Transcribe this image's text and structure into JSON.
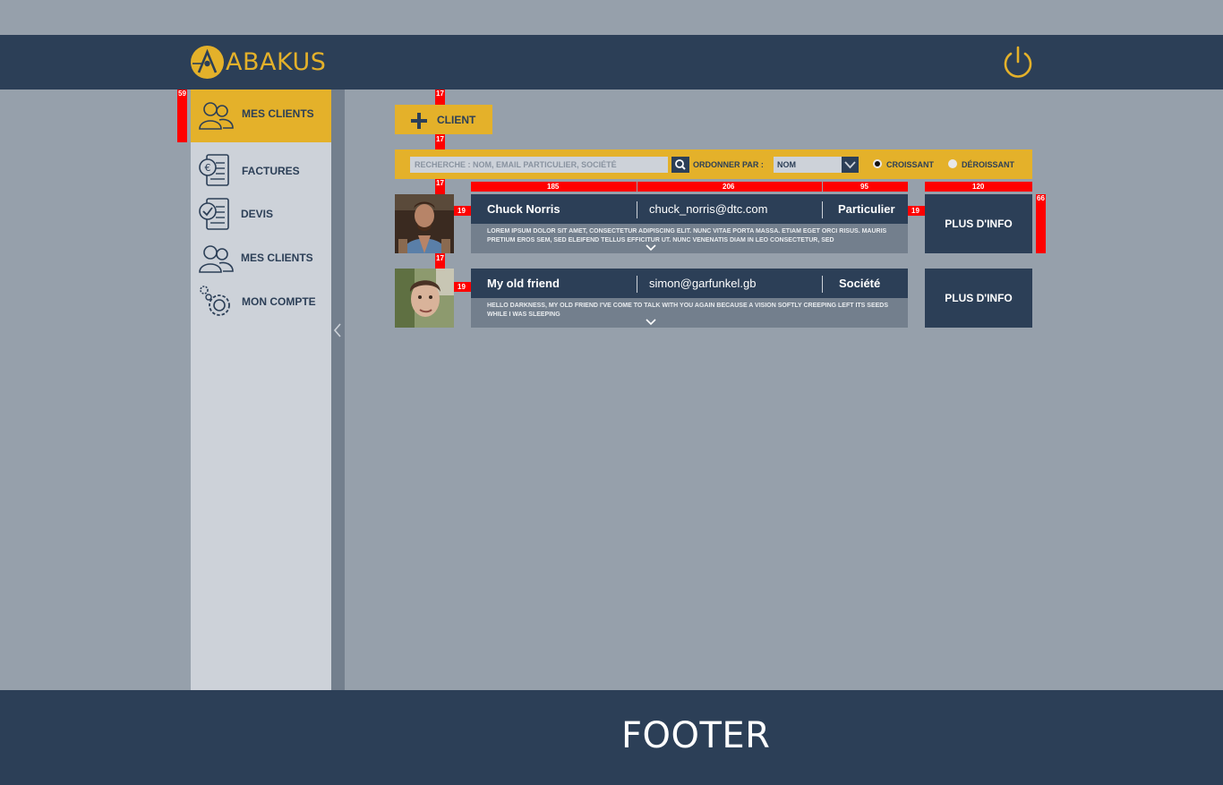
{
  "header": {
    "logo_text": "ABAKUS",
    "accent_color": "#e4b12a",
    "background_color": "#2c3f57",
    "power_icon": "power-icon"
  },
  "sidebar": {
    "items": [
      {
        "label": "MES CLIENTS",
        "icon": "clients-icon",
        "active": true
      },
      {
        "label": "FACTURES",
        "icon": "invoice-euro-icon"
      },
      {
        "label": "DEVIS",
        "icon": "quote-check-icon"
      },
      {
        "label": "MES CLIENTS",
        "icon": "clients-icon"
      },
      {
        "label": "MON COMPTE",
        "icon": "gears-icon"
      }
    ],
    "collapse_icon": "chevron-left-icon"
  },
  "toolbar": {
    "add_client_label": "CLIENT"
  },
  "filters": {
    "search_placeholder": "RECHERCHE : NOM, EMAIL PARTICULIER, SOCIÉTÉ",
    "order_label": "ORDONNER PAR :",
    "order_value": "NOM",
    "asc_label": "CROISSANT",
    "desc_label": "DÉROISSANT",
    "sort": "CROISSANT"
  },
  "clients": [
    {
      "name": "Chuck Norris",
      "email": "chuck_norris@dtc.com",
      "type": "Particulier",
      "description": "LOREM IPSUM DOLOR SIT AMET, CONSECTETUR ADIPISCING ELIT. NUNC VITAE PORTA MASSA. ETIAM EGET ORCI RISUS. MAURIS PRETIUM EROS SEM, SED ELEIFEND TELLUS EFFICITUR UT. NUNC VENENATIS DIAM IN LEO CONSECTETUR, SED",
      "button": "PLUS D'INFO"
    },
    {
      "name": "My old friend",
      "email": "simon@garfunkel.gb",
      "type": "Société",
      "description": "HELLO DARKNESS, MY OLD FRIEND I'VE COME TO TALK WITH YOU AGAIN BECAUSE A VISION SOFTLY CREEPING LEFT ITS SEEDS WHILE I WAS SLEEPING",
      "button": "PLUS D'INFO"
    }
  ],
  "annotations": {
    "sidebar_item_height": "59",
    "gap_a": "17",
    "gap_b": "17",
    "gap_c": "17",
    "gap_d": "17",
    "avatar_gap": "19",
    "avatar_gap_2": "19",
    "card_gap": "19",
    "col_name": "185",
    "col_email": "206",
    "col_type": "95",
    "col_button": "120",
    "row_height": "66"
  },
  "footer": {
    "text": "FOOTER"
  }
}
